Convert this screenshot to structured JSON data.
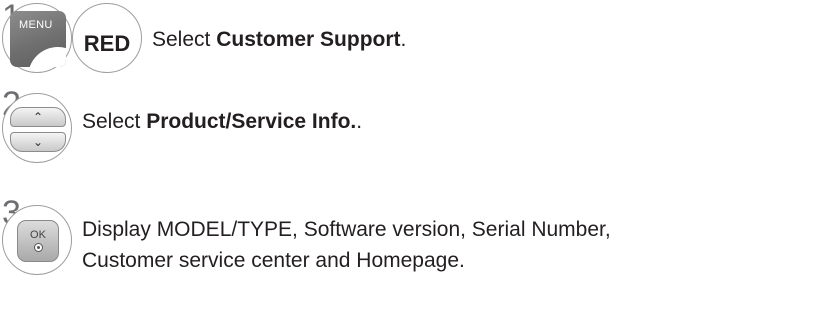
{
  "steps": [
    {
      "number": "1",
      "keys": [
        {
          "label": "MENU",
          "icon": "menu-key"
        },
        {
          "label": "RED",
          "icon": "red-key"
        }
      ],
      "text_prefix": "Select ",
      "text_bold": "Customer Support",
      "text_suffix": "."
    },
    {
      "number": "2",
      "keys": [
        {
          "label": "^",
          "icon": "up-key"
        },
        {
          "label": "v",
          "icon": "down-key"
        }
      ],
      "text_prefix": "Select ",
      "text_bold": "Product/Service Info.",
      "text_suffix": "."
    },
    {
      "number": "3",
      "keys": [
        {
          "label": "OK",
          "icon": "ok-key"
        }
      ],
      "text_line1": "Display MODEL/TYPE, Software version, Serial Number,",
      "text_line2": "Customer service center and Homepage."
    }
  ]
}
